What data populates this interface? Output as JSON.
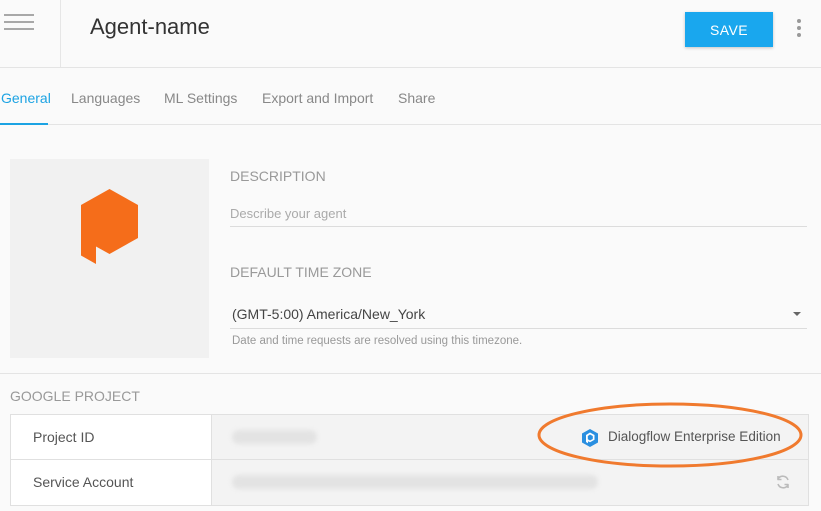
{
  "header": {
    "agent_name": "Agent-name",
    "save_label": "SAVE",
    "menu_icon": "hamburger-icon",
    "more_icon": "more-vertical-icon"
  },
  "tabs": [
    {
      "label": "General",
      "active": true
    },
    {
      "label": "Languages",
      "active": false
    },
    {
      "label": "ML Settings",
      "active": false
    },
    {
      "label": "Export and Import",
      "active": false
    },
    {
      "label": "Share",
      "active": false
    }
  ],
  "avatar": {
    "icon": "dialogflow-logo-icon",
    "color": "#f56d1a"
  },
  "form": {
    "description_label": "DESCRIPTION",
    "description_placeholder": "Describe your agent",
    "description_value": "",
    "timezone_label": "DEFAULT TIME ZONE",
    "timezone_value": "(GMT-5:00) America/New_York",
    "timezone_hint": "Date and time requests are resolved using this timezone."
  },
  "google_project": {
    "title": "GOOGLE PROJECT",
    "project_id_label": "Project ID",
    "service_account_label": "Service Account",
    "edition_label": "Dialogflow Enterprise Edition",
    "edition_icon": "dialogflow-enterprise-icon",
    "refresh_icon": "refresh-icon"
  },
  "colors": {
    "accent": "#1ca3e3",
    "save_button": "#19a7ee",
    "logo": "#f56d1a",
    "highlight_ellipse": "#f07a2e"
  }
}
